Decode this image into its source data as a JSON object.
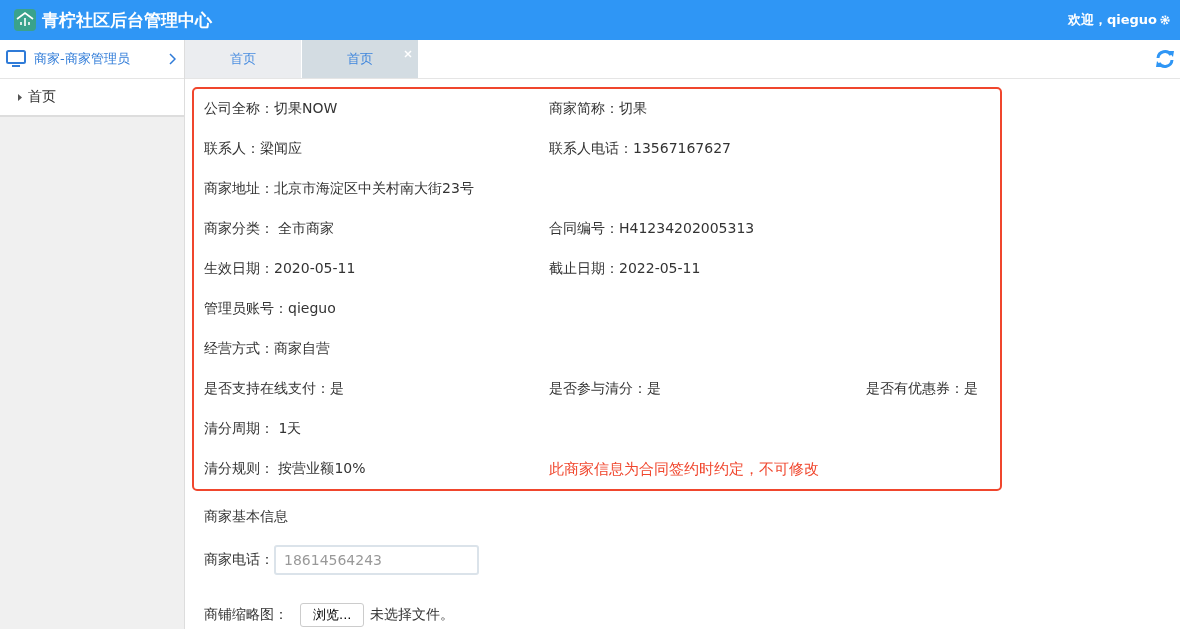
{
  "header": {
    "title": "青柠社区后台管理中心",
    "welcome": "欢迎，qieguo"
  },
  "sidebar": {
    "section": "商家-商家管理员",
    "items": [
      {
        "label": "首页",
        "selected": false
      }
    ]
  },
  "tabs": [
    {
      "label": "首页",
      "selected": false,
      "closable": false
    },
    {
      "label": "首页",
      "selected": true,
      "closable": true
    }
  ],
  "info_rows": [
    [
      {
        "text": "公司全称：切果NOW"
      },
      {
        "text": "商家简称：切果"
      }
    ],
    [
      {
        "text": "联系人：梁闻应"
      },
      {
        "text": "联系人电话：13567167627"
      }
    ],
    [
      {
        "text": "商家地址：北京市海淀区中关村南大街23号"
      }
    ],
    [
      {
        "text": "商家分类： 全市商家"
      },
      {
        "text": "合同编号：H41234202005313"
      }
    ],
    [
      {
        "text": "生效日期：2020-05-11"
      },
      {
        "text": "截止日期：2022-05-11"
      }
    ],
    [
      {
        "text": "管理员账号：qieguo"
      }
    ],
    [
      {
        "text": "经营方式：商家自营"
      }
    ],
    [
      {
        "text": "是否支持在线支付：是"
      },
      {
        "text": "是否参与清分：是"
      },
      {
        "text": "是否有优惠券：是"
      }
    ],
    [
      {
        "text": "清分周期： 1天"
      }
    ],
    [
      {
        "text": "清分规则： 按营业额10%"
      }
    ]
  ],
  "notice": "此商家信息为合同签约时约定，不可修改",
  "basic_info": {
    "heading": "商家基本信息",
    "phone_label": "商家电话：",
    "phone_placeholder": "18614564243",
    "thumbnail_label": "商铺缩略图：",
    "browse_button": "浏览...",
    "file_status": "未选择文件。"
  }
}
